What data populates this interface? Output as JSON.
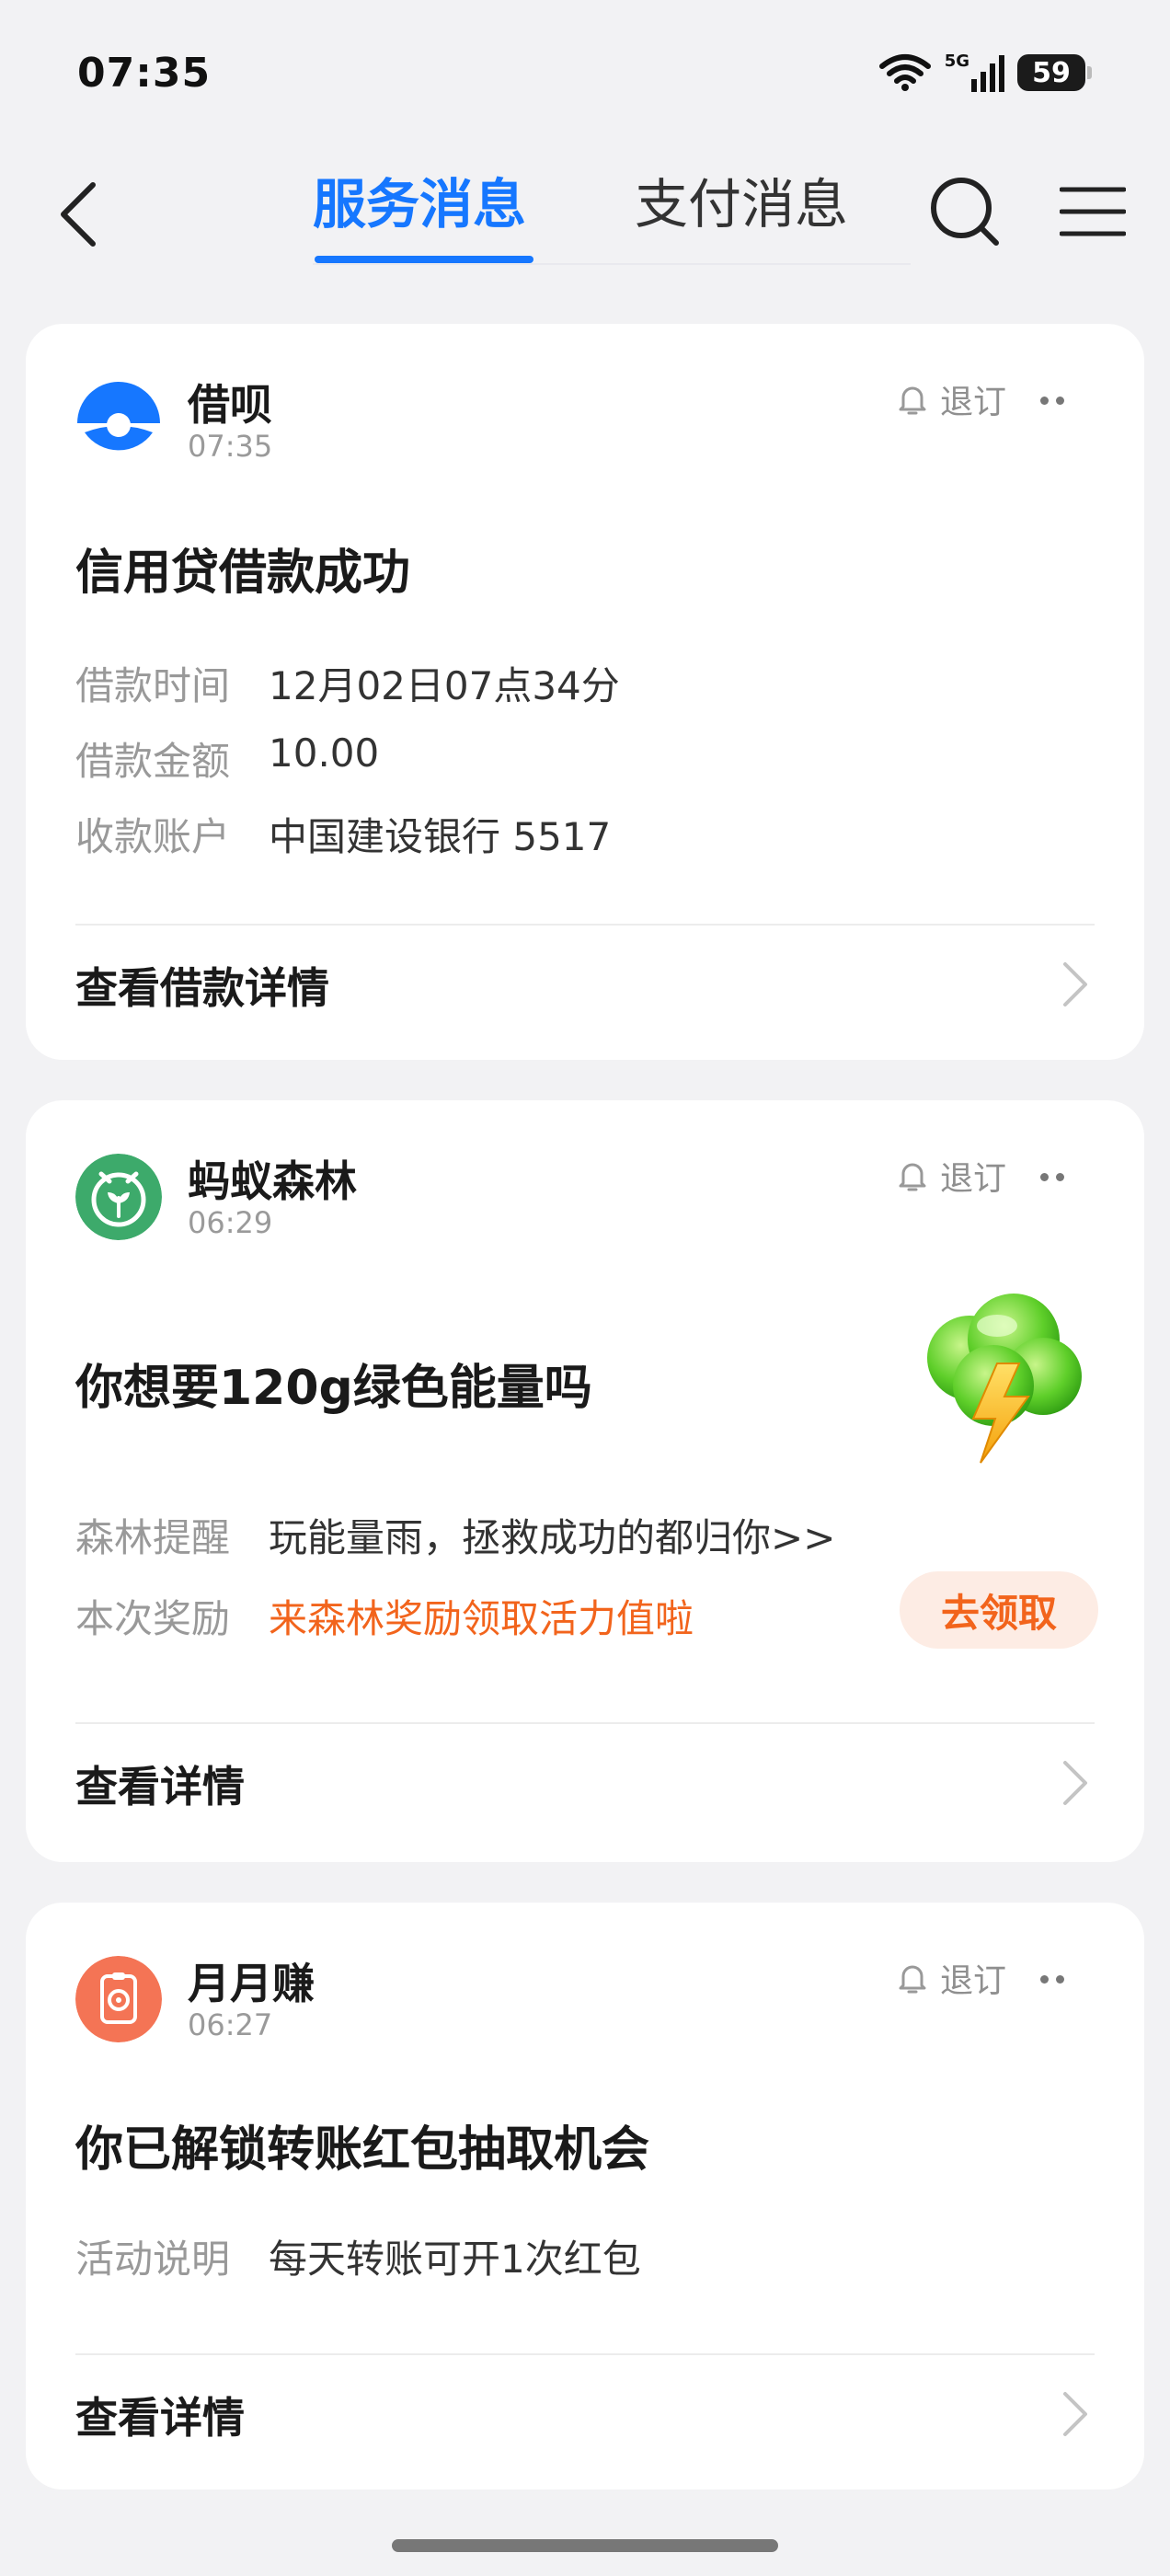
{
  "status_bar": {
    "time": "07:35",
    "network": "5G",
    "battery": "59"
  },
  "nav": {
    "tabs": [
      {
        "label": "服务消息",
        "active": true
      },
      {
        "label": "支付消息",
        "active": false
      }
    ]
  },
  "unsubscribe_label": "退订",
  "colors": {
    "accent": "#1677ff",
    "orange": "#f2641c"
  },
  "cards": [
    {
      "sender": "借呗",
      "time": "07:35",
      "title": "信用贷借款成功",
      "fields": [
        {
          "key": "借款时间",
          "value": "12月02日07点34分"
        },
        {
          "key": "借款金额",
          "value": "10.00"
        },
        {
          "key": "收款账户",
          "value": "中国建设银行 5517"
        }
      ],
      "link": "查看借款详情",
      "avatar_icon": "jiebei-logo-icon"
    },
    {
      "sender": "蚂蚁森林",
      "time": "06:29",
      "title": "你想要120g绿色能量吗",
      "fields": [
        {
          "key": "森林提醒",
          "value": "玩能量雨，拯救成功的都归你>>"
        },
        {
          "key": "本次奖励",
          "value": "来森林奖励领取活力值啦"
        }
      ],
      "action_button": "去领取",
      "link": "查看详情",
      "avatar_icon": "ant-forest-logo-icon",
      "illustration": "energy-rain-cloud-icon"
    },
    {
      "sender": "月月赚",
      "time": "06:27",
      "title": "你已解锁转账红包抽取机会",
      "fields": [
        {
          "key": "活动说明",
          "value": "每天转账可开1次红包"
        }
      ],
      "link": "查看详情",
      "avatar_icon": "yueyuezhuan-logo-icon"
    }
  ]
}
